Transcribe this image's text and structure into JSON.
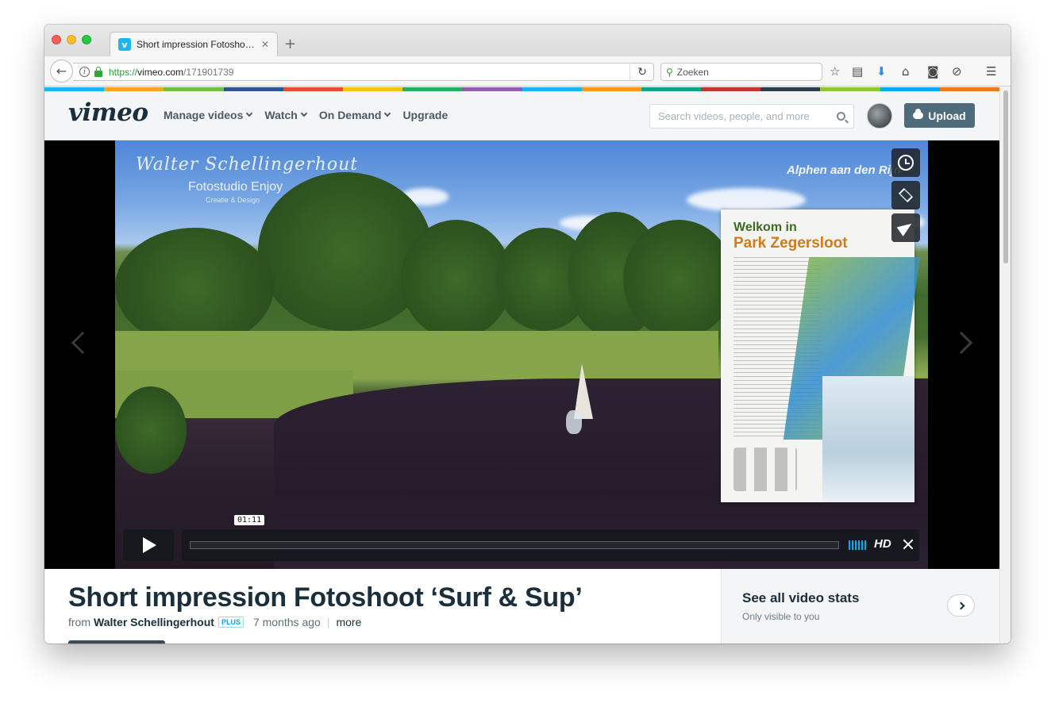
{
  "browser": {
    "tab_title": "Short impression Fotoshoot…",
    "tab_favicon": "v",
    "url_prefix": "https://",
    "url_host": "vimeo.com",
    "url_path": "/171901739",
    "search_placeholder": "Zoeken"
  },
  "vimeo": {
    "logo": "vimeo",
    "nav": {
      "manage_videos": "Manage videos",
      "watch": "Watch",
      "on_demand": "On Demand",
      "upgrade": "Upgrade"
    },
    "search_placeholder": "Search videos, people, and more",
    "upload_label": "Upload",
    "brand_color": "#1ab7ea"
  },
  "video": {
    "overlay_name": "Walter Schellingerhout",
    "overlay_studio": "Fotostudio Enjoy",
    "overlay_tag": "Creatie & Design",
    "overlay_place": "Alphen aan den Rijn",
    "sign_line1": "Welkom in",
    "sign_line2": "Park Zegersloot",
    "timecode": "01:11",
    "progress": 0.0,
    "hd_label": "HD"
  },
  "info": {
    "title": "Short impression Fotoshoot ‘Surf & Sup’",
    "from_label": "from",
    "author": "Walter Schellingerhout",
    "badge": "PLUS",
    "posted": "7 months ago",
    "more_label": "more",
    "stats_title": "See all video stats",
    "stats_sub": "Only visible to you"
  }
}
